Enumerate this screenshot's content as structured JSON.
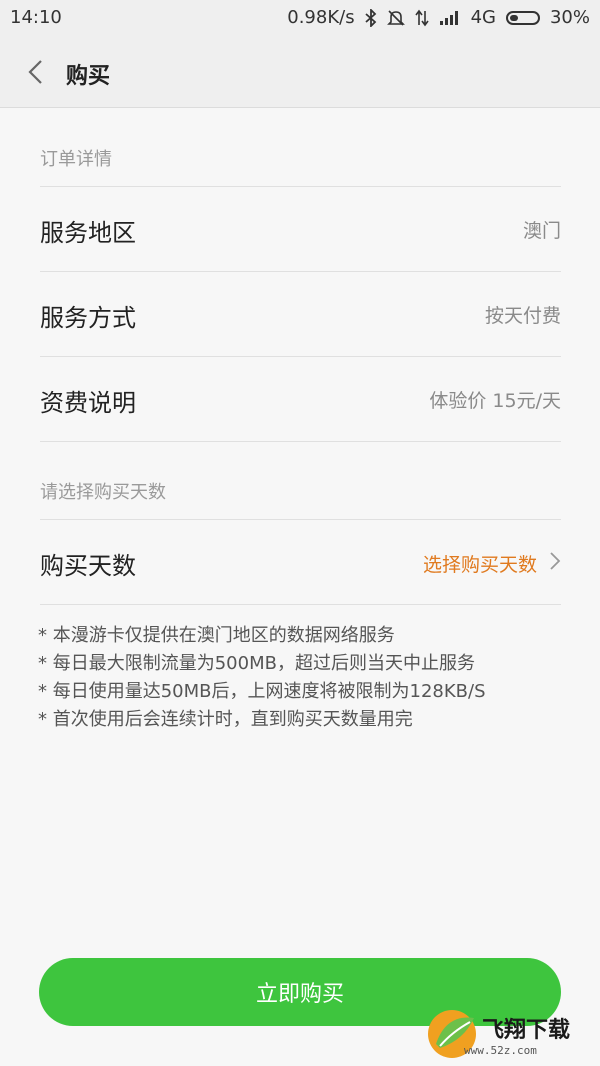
{
  "status_bar": {
    "time": "14:10",
    "net_speed": "0.98K/s",
    "network": "4G",
    "battery": "30%",
    "battery_level": 0.3
  },
  "header": {
    "title": "购买",
    "back_icon": "chevron-left-icon"
  },
  "order_section": {
    "label": "订单详情",
    "rows": [
      {
        "label": "服务地区",
        "value": "澳门"
      },
      {
        "label": "服务方式",
        "value": "按天付费"
      },
      {
        "label": "资费说明",
        "value": "体验价 15元/天"
      }
    ]
  },
  "days_section": {
    "label": "请选择购买天数",
    "row": {
      "label": "购买天数",
      "value": "选择购买天数"
    }
  },
  "notes": [
    "* 本漫游卡仅提供在澳门地区的数据网络服务",
    "* 每日最大限制流量为500MB，超过后则当天中止服务",
    "* 每日使用量达50MB后，上网速度将被限制为128KB/S",
    "* 首次使用后会连续计时，直到购买天数量用完"
  ],
  "buy_button": {
    "label": "立即购买"
  },
  "watermark": {
    "text": "飞翔下载",
    "sub": "www.52z.com"
  },
  "colors": {
    "accent": "#e07a1f",
    "button": "#3ec53e"
  }
}
